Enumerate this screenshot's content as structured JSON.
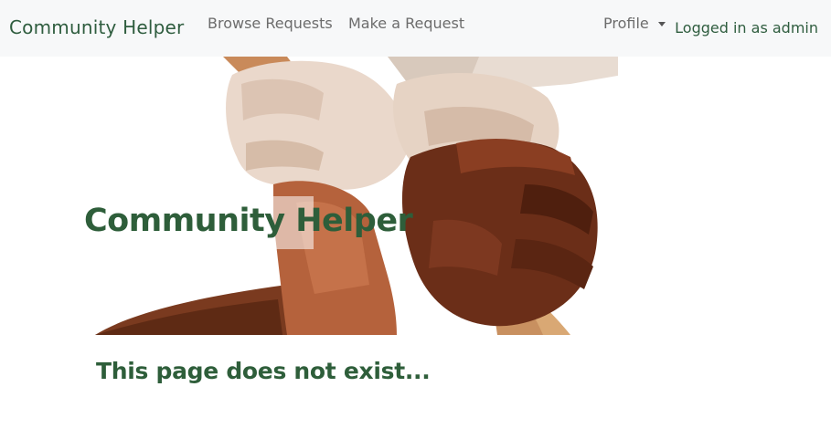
{
  "navbar": {
    "brand": "Community Helper",
    "links": [
      "Browse Requests",
      "Make a Request"
    ],
    "profile_label": "Profile",
    "logged_in_text": "Logged in as admin"
  },
  "hero": {
    "title": "Community Helper",
    "image_name": "hands-holding-wrists-image"
  },
  "message": "This page does not exist...",
  "colors": {
    "brand_green": "#2e5e3a",
    "nav_bg": "#f7f8f9",
    "nav_link": "#6c6c6c"
  }
}
